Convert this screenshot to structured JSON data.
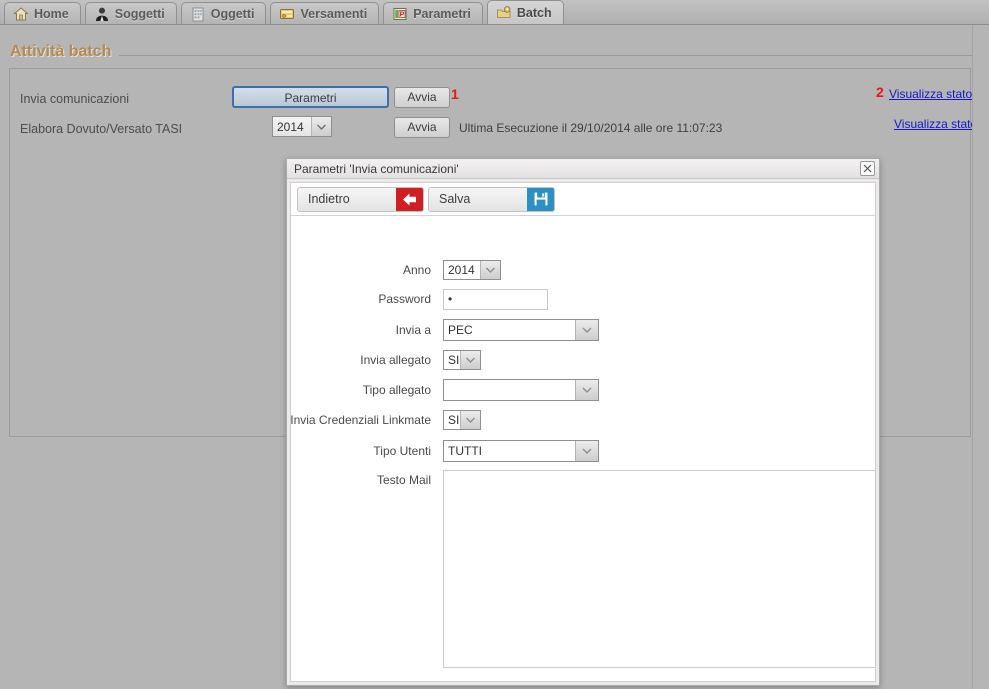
{
  "tabs": [
    {
      "label": "Home",
      "icon": "home-icon",
      "active": false
    },
    {
      "label": "Soggetti",
      "icon": "person-icon",
      "active": false
    },
    {
      "label": "Oggetti",
      "icon": "building-icon",
      "active": false
    },
    {
      "label": "Versamenti",
      "icon": "payment-icon",
      "active": false
    },
    {
      "label": "Parametri",
      "icon": "parameters-icon",
      "active": false
    },
    {
      "label": "Batch",
      "icon": "batch-gear-icon",
      "active": true
    }
  ],
  "page": {
    "title": "Attività batch"
  },
  "batch_rows": [
    {
      "label": "Invia comunicazioni",
      "parametri_button": "Parametri",
      "avvia_button": "Avvia",
      "marker": "1",
      "last_run": "",
      "status_marker": "2",
      "status_link": "Visualizza stato"
    },
    {
      "label": "Elabora Dovuto/Versato TASI",
      "year_value": "2014",
      "avvia_button": "Avvia",
      "marker": "",
      "last_run": "Ultima Esecuzione il 29/10/2014 alle ore 11:07:23",
      "status_marker": "",
      "status_link": "Visualizza stato"
    }
  ],
  "modal": {
    "title": "Parametri 'Invia comunicazioni'",
    "close_label": "×",
    "toolbar": {
      "back_label": "Indietro",
      "back_icon": "left-arrow-icon",
      "save_label": "Salva",
      "save_icon": "floppy-disk-icon"
    },
    "fields": [
      {
        "label": "Anno",
        "type": "select",
        "value": "2014"
      },
      {
        "label": "Password",
        "type": "password",
        "value": "•"
      },
      {
        "label": "Invia a",
        "type": "select",
        "value": "PEC"
      },
      {
        "label": "Invia allegato",
        "type": "select",
        "value": "SI"
      },
      {
        "label": "Tipo allegato",
        "type": "select",
        "value": ""
      },
      {
        "label": "Invia Credenziali Linkmate",
        "type": "select",
        "value": "SI"
      },
      {
        "label": "Tipo Utenti",
        "type": "select",
        "value": "TUTTI"
      },
      {
        "label": "Testo Mail",
        "type": "textarea",
        "value": ""
      }
    ]
  },
  "colors": {
    "accent_title": "#b58a4f",
    "marker_red": "#e8151c",
    "link_blue": "#1616c8",
    "focus_blue": "#3f6fa8",
    "toolbar_red": "#cf1f24",
    "toolbar_blue": "#2d8fc4"
  }
}
